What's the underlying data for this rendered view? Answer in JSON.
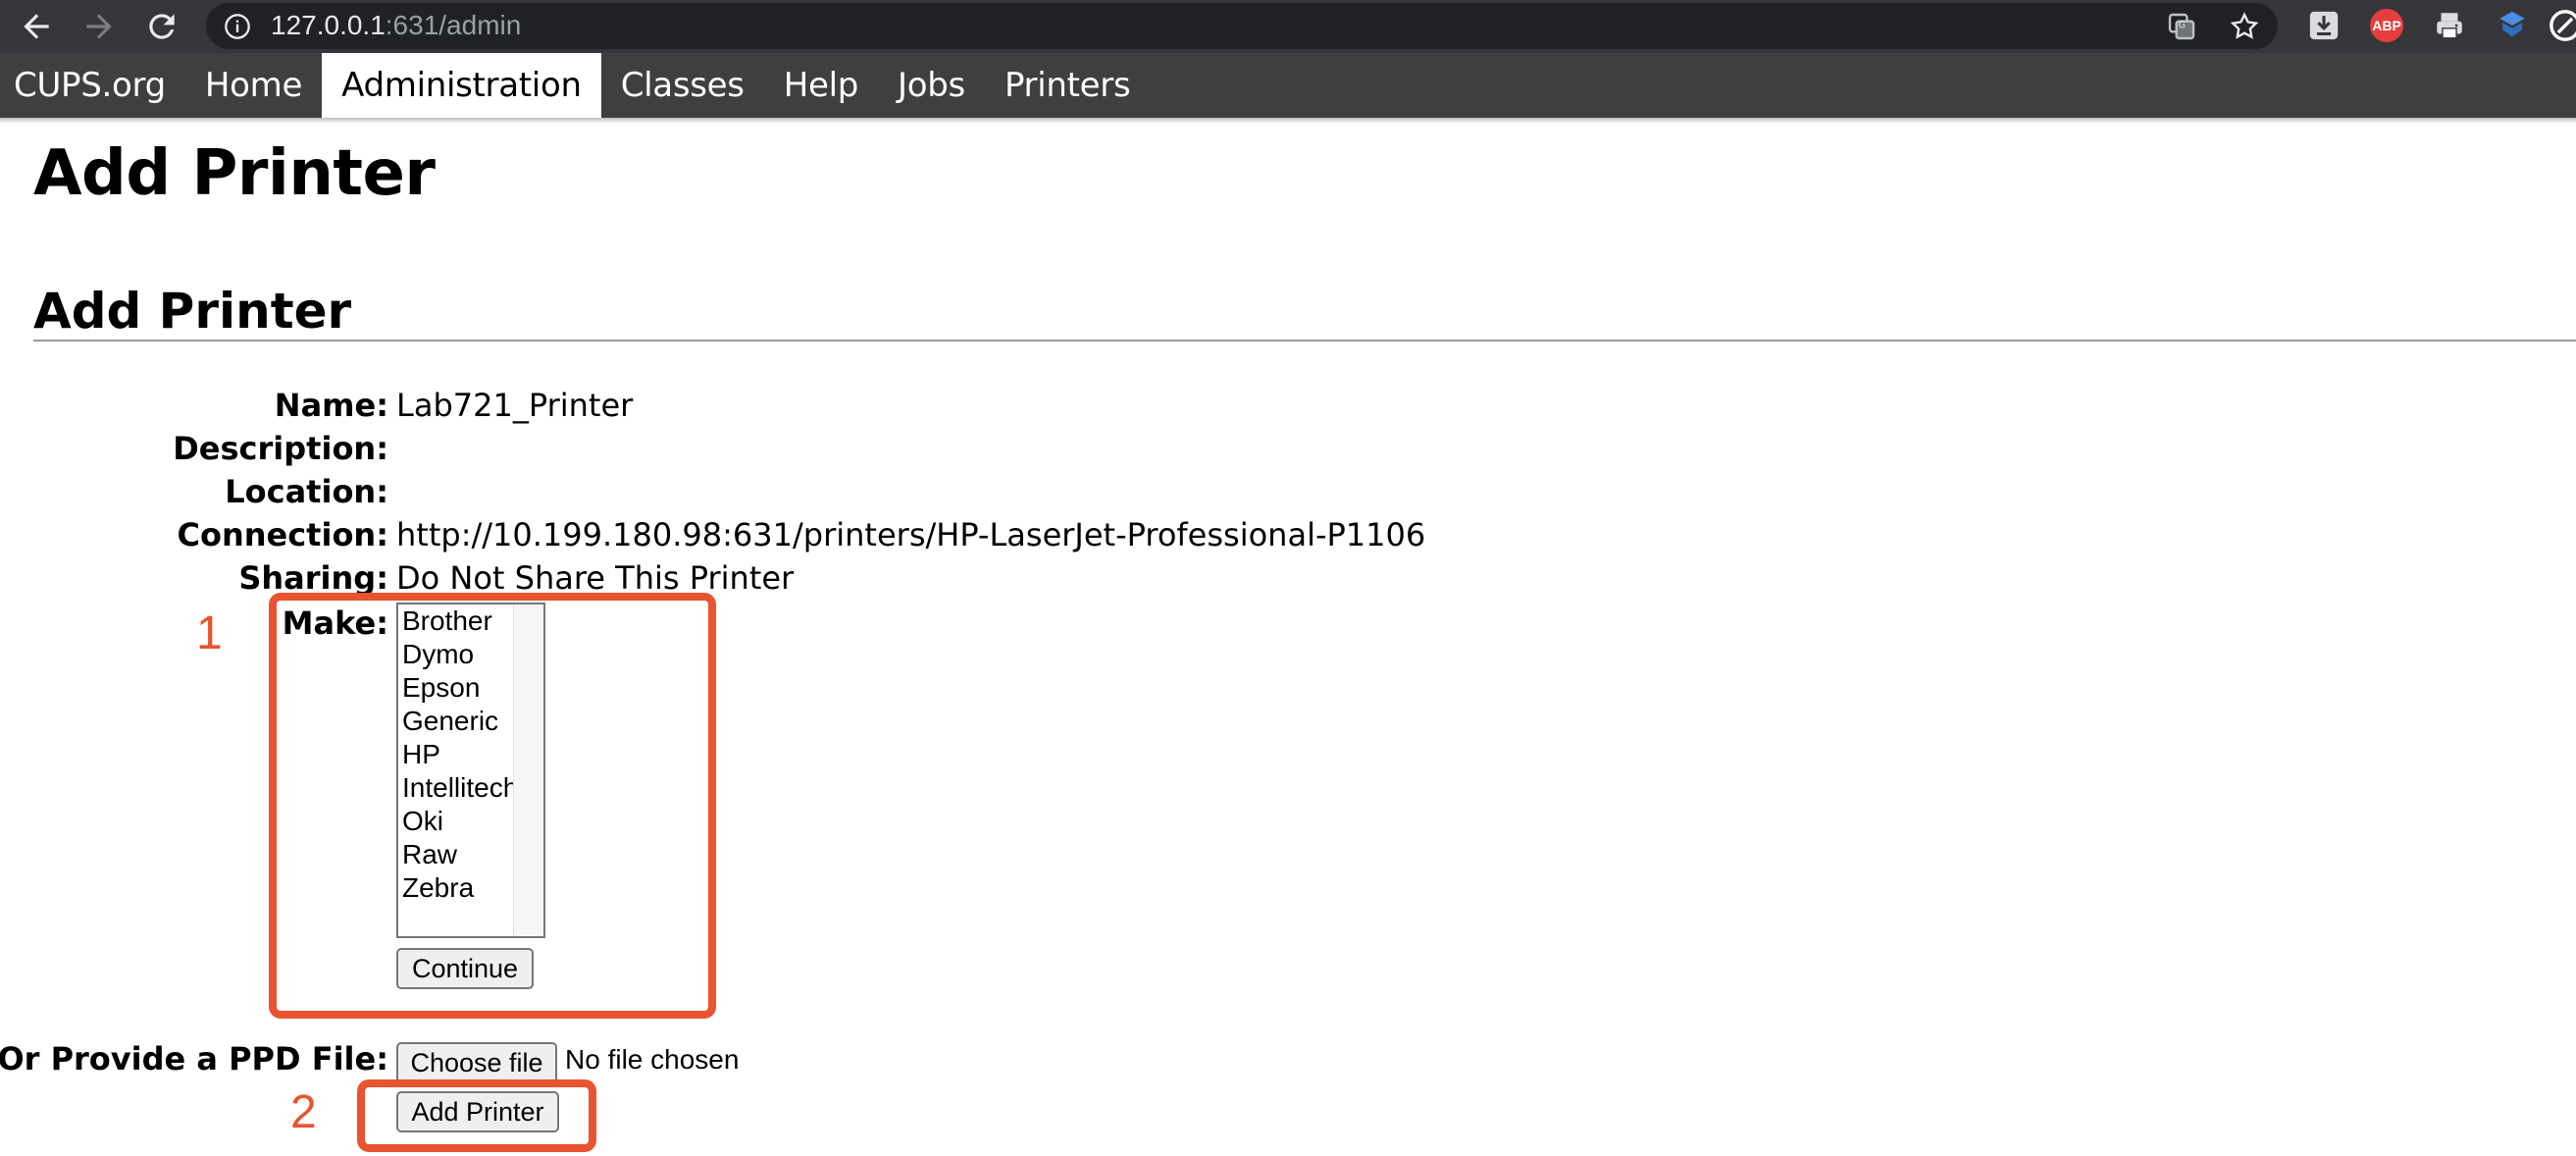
{
  "browser": {
    "url_host": "127.0.0.1",
    "url_path": ":631/admin"
  },
  "nav": {
    "items": [
      {
        "label": "CUPS.org"
      },
      {
        "label": "Home"
      },
      {
        "label": "Administration",
        "active": true
      },
      {
        "label": "Classes"
      },
      {
        "label": "Help"
      },
      {
        "label": "Jobs"
      },
      {
        "label": "Printers"
      }
    ]
  },
  "page": {
    "title": "Add Printer",
    "section_title": "Add Printer"
  },
  "form": {
    "name_label": "Name:",
    "name_value": "Lab721_Printer",
    "description_label": "Description:",
    "description_value": "",
    "location_label": "Location:",
    "location_value": "",
    "connection_label": "Connection:",
    "connection_value": "http://10.199.180.98:631/printers/HP-LaserJet-Professional-P1106",
    "sharing_label": "Sharing:",
    "sharing_value": "Do Not Share This Printer",
    "make_label": "Make:",
    "make_options": [
      "Brother",
      "Dymo",
      "Epson",
      "Generic",
      "HP",
      "Intellitech",
      "Oki",
      "Raw",
      "Zebra"
    ],
    "continue_label": "Continue",
    "ppd_label": "Or Provide a PPD File:",
    "choose_file_label": "Choose file",
    "no_file_text": "No file chosen",
    "add_printer_label": "Add Printer"
  },
  "annotations": {
    "marker_1": "1",
    "marker_2": "2",
    "color": "#e9532f"
  },
  "icons": [
    "back-arrow-icon",
    "forward-arrow-icon",
    "reload-icon",
    "info-icon",
    "translate-icon",
    "star-icon",
    "download-icon",
    "adblock-icon",
    "printer-extension-icon",
    "shield-extension-icon",
    "profile-icon"
  ]
}
